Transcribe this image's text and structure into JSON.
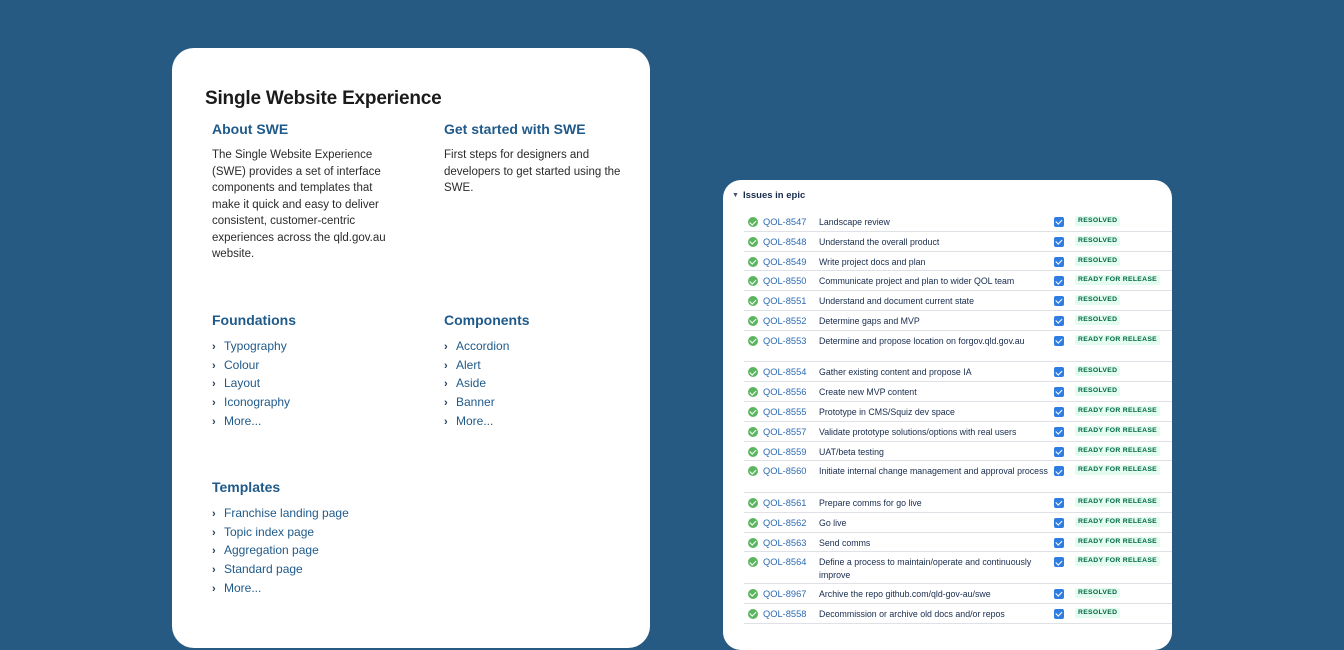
{
  "swe": {
    "title": "Single Website Experience",
    "about": {
      "heading": "About SWE",
      "text": "The Single Website Experience (SWE) provides a set of interface components and templates that make it quick and easy to deliver consistent, customer-centric experiences across the qld.gov.au website."
    },
    "get_started": {
      "heading": "Get started with SWE",
      "text": "First steps for designers and developers to get started using the SWE."
    },
    "foundations": {
      "heading": "Foundations",
      "items": [
        "Typography",
        "Colour",
        "Layout",
        "Iconography",
        "More..."
      ]
    },
    "components": {
      "heading": "Components",
      "items": [
        "Accordion",
        "Alert",
        "Aside",
        "Banner",
        "More..."
      ]
    },
    "templates": {
      "heading": "Templates",
      "items": [
        "Franchise landing page",
        "Topic index page",
        "Aggregation page",
        "Standard page",
        "More..."
      ]
    }
  },
  "epic": {
    "header": "Issues in epic",
    "issues": [
      {
        "key": "QOL-8547",
        "summary": "Landscape review",
        "status": "RESOLVED"
      },
      {
        "key": "QOL-8548",
        "summary": "Understand the overall product",
        "status": "RESOLVED"
      },
      {
        "key": "QOL-8549",
        "summary": "Write project docs and plan",
        "status": "RESOLVED"
      },
      {
        "key": "QOL-8550",
        "summary": "Communicate project and plan to wider QOL team",
        "status": "READY FOR RELEASE"
      },
      {
        "key": "QOL-8551",
        "summary": "Understand and document current state",
        "status": "RESOLVED"
      },
      {
        "key": "QOL-8552",
        "summary": "Determine gaps and MVP",
        "status": "RESOLVED"
      },
      {
        "key": "QOL-8553",
        "summary": "Determine and propose location on forgov.qld.gov.au",
        "status": "READY FOR RELEASE"
      },
      {
        "key": "QOL-8554",
        "summary": "Gather existing content and propose IA",
        "status": "RESOLVED"
      },
      {
        "key": "QOL-8556",
        "summary": "Create new MVP content",
        "status": "RESOLVED"
      },
      {
        "key": "QOL-8555",
        "summary": "Prototype in CMS/Squiz dev space",
        "status": "READY FOR RELEASE"
      },
      {
        "key": "QOL-8557",
        "summary": "Validate prototype solutions/options with real users",
        "status": "READY FOR RELEASE"
      },
      {
        "key": "QOL-8559",
        "summary": "UAT/beta testing",
        "status": "READY FOR RELEASE"
      },
      {
        "key": "QOL-8560",
        "summary": "Initiate internal change management and approval process",
        "status": "READY FOR RELEASE"
      },
      {
        "key": "QOL-8561",
        "summary": "Prepare comms for go live",
        "status": "READY FOR RELEASE"
      },
      {
        "key": "QOL-8562",
        "summary": "Go live",
        "status": "READY FOR RELEASE"
      },
      {
        "key": "QOL-8563",
        "summary": "Send comms",
        "status": "READY FOR RELEASE"
      },
      {
        "key": "QOL-8564",
        "summary": "Define a process to maintain/operate and continuously improve",
        "status": "READY FOR RELEASE"
      },
      {
        "key": "QOL-8967",
        "summary": "Archive the repo github.com/qld-gov-au/swe",
        "status": "RESOLVED"
      },
      {
        "key": "QOL-8558",
        "summary": "Decommission or archive old docs and/or repos",
        "status": "RESOLVED"
      }
    ]
  },
  "icons": {
    "list_chevron": "chevron-right-icon",
    "section_caret": "caret-down-icon",
    "issue_status": "check-circle-icon",
    "issue_checkbox": "checkbox-checked-icon"
  },
  "colors": {
    "background": "#275a82",
    "link": "#1f5a8a",
    "issue_key": "#2d6ab2",
    "status_done": "#5bb55f",
    "checkbox": "#2f7de1",
    "lozenge_bg": "#e3fcef",
    "lozenge_text": "#006644"
  }
}
